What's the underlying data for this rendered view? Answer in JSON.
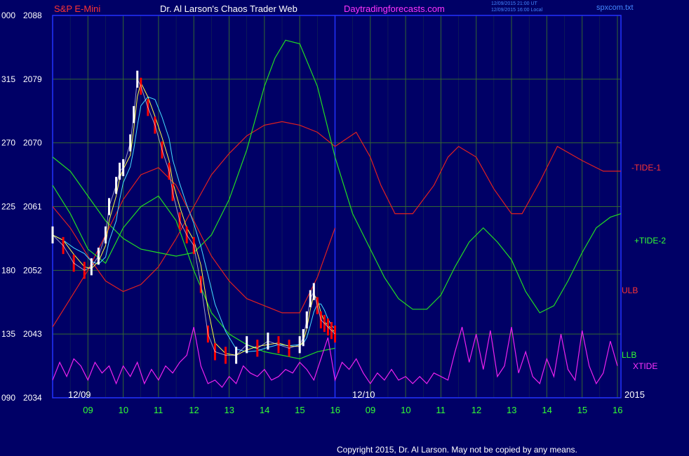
{
  "header": {
    "instrument": "S&P E-Mini",
    "title": "Dr. Al Larson's Chaos Trader Web",
    "site": "Daytradingforecasts.com",
    "timestamp_line1": "12/09/2015 21:00 UT",
    "timestamp_line2": "12/09/2015 16:00 Local",
    "file": "spxcom.txt"
  },
  "footer": {
    "copyright": "Copyright 2015, Dr. Al Larson. May not be copied by any means.",
    "year": "2015"
  },
  "colors": {
    "background": "#000066",
    "grid": "#336633",
    "frame": "#2233ff",
    "price": "#ffffff",
    "price_down": "#ff0000",
    "tide1": "#e02020",
    "tide2": "#22dd22",
    "xtide": "#ee22ee",
    "ma_yellow": "#ffff44",
    "ma_cyan": "#44ddff",
    "ulb": "#e02020",
    "llb": "#22dd22",
    "label_red": "#ff3333",
    "label_green": "#33ff33",
    "label_magenta": "#ff33ff",
    "tick_text": "#ffffff"
  },
  "chart_data": {
    "type": "line",
    "title": "Dr. Al Larson's Chaos Trader Web",
    "y_right_ticks": [
      "2088",
      "2079",
      "2070",
      "2061",
      "2052",
      "2043",
      "2034"
    ],
    "y_left_ticks": [
      "000",
      "315",
      "270",
      "225",
      "180",
      "135",
      "090"
    ],
    "ylim": [
      2034,
      2088
    ],
    "x_ticks": [
      "09",
      "10",
      "11",
      "12",
      "13",
      "14",
      "15",
      "16",
      "09",
      "10",
      "11",
      "12",
      "13",
      "14",
      "15",
      "16"
    ],
    "date_labels": [
      "12/09",
      "12/10"
    ],
    "now_marker": "16 (12/09 close)",
    "series": [
      {
        "name": "S&P E-Mini",
        "kind": "price",
        "x": [
          8.0,
          8.3,
          8.6,
          8.9,
          9.1,
          9.3,
          9.5,
          9.6,
          9.8,
          9.9,
          10.0,
          10.2,
          10.3,
          10.4,
          10.5,
          10.7,
          10.9,
          11.1,
          11.3,
          11.4,
          11.6,
          11.8,
          12.0,
          12.2,
          12.4,
          12.6,
          12.9,
          13.2,
          13.5,
          13.8,
          14.1,
          14.4,
          14.7,
          15.0,
          15.1,
          15.2,
          15.3,
          15.4,
          15.5,
          15.6,
          15.7,
          15.8,
          15.9,
          16.0
        ],
        "y": [
          2057.0,
          2055.5,
          2053.0,
          2052.0,
          2052.5,
          2054.0,
          2057.0,
          2061.0,
          2064.0,
          2066.0,
          2066.5,
          2070.0,
          2074.0,
          2079.0,
          2078.0,
          2075.0,
          2072.5,
          2069.0,
          2066.0,
          2063.0,
          2059.0,
          2057.0,
          2055.5,
          2050.0,
          2043.0,
          2040.5,
          2040.0,
          2040.0,
          2041.5,
          2041.0,
          2042.0,
          2041.5,
          2041.0,
          2041.5,
          2042.5,
          2045.0,
          2048.0,
          2049.0,
          2047.0,
          2045.0,
          2044.5,
          2044.0,
          2043.5,
          2043.0
        ]
      },
      {
        "name": "-TIDE-1",
        "kind": "tide",
        "x": [
          8.0,
          8.5,
          9.0,
          9.5,
          10.0,
          10.5,
          11.0,
          11.5,
          12.0,
          12.5,
          13.0,
          13.5,
          14.0,
          14.5,
          15.0,
          15.5,
          16.0,
          16.6,
          17.0,
          17.3,
          17.7,
          18.2,
          18.8,
          19.2,
          19.5,
          20.0,
          20.5,
          21.0,
          21.3,
          21.8,
          22.3,
          23.0,
          23.6,
          24.1
        ],
        "y": [
          2061.0,
          2058.0,
          2054.0,
          2050.5,
          2049.0,
          2050.0,
          2052.5,
          2056.5,
          2061.0,
          2065.5,
          2068.5,
          2071.0,
          2072.5,
          2073.0,
          2072.5,
          2071.5,
          2069.5,
          2071.5,
          2068.0,
          2064.0,
          2060.0,
          2060.0,
          2064.0,
          2068.0,
          2069.5,
          2068.0,
          2063.5,
          2060.0,
          2060.0,
          2064.5,
          2069.5,
          2067.5,
          2066.0,
          2066.0
        ]
      },
      {
        "name": "+TIDE-2",
        "kind": "tide",
        "x": [
          8.0,
          8.5,
          9.0,
          9.5,
          10.0,
          10.5,
          11.0,
          11.5,
          12.0,
          12.5,
          13.0,
          13.5,
          14.0,
          14.3,
          14.6,
          15.0,
          15.5,
          16.0,
          16.5,
          17.0,
          17.4,
          17.8,
          18.2,
          18.6,
          19.0,
          19.4,
          19.8,
          20.2,
          20.6,
          21.0,
          21.4,
          21.8,
          22.2,
          22.6,
          23.0,
          23.4,
          23.8,
          24.1
        ],
        "y": [
          2068.0,
          2066.0,
          2062.5,
          2059.0,
          2056.5,
          2055.0,
          2054.5,
          2054.0,
          2054.5,
          2057.0,
          2062.0,
          2069.0,
          2078.0,
          2082.0,
          2084.5,
          2084.0,
          2078.0,
          2068.0,
          2060.0,
          2055.0,
          2051.0,
          2048.0,
          2046.5,
          2046.5,
          2048.5,
          2052.5,
          2056.0,
          2058.0,
          2056.0,
          2053.5,
          2049.0,
          2046.0,
          2047.0,
          2050.5,
          2054.5,
          2058.0,
          2059.5,
          2060.0
        ]
      },
      {
        "name": "ULB",
        "kind": "band",
        "x": [
          8.0,
          8.5,
          9.0,
          9.5,
          10.0,
          10.5,
          11.0,
          11.5,
          12.0,
          12.5,
          13.0,
          13.5,
          14.0,
          14.5,
          15.0,
          15.5,
          16.0
        ],
        "y": [
          2044.0,
          2048.0,
          2052.0,
          2057.0,
          2062.0,
          2065.5,
          2066.5,
          2064.0,
          2059.0,
          2054.0,
          2050.5,
          2048.0,
          2047.0,
          2046.0,
          2046.0,
          2051.0,
          2058.0
        ]
      },
      {
        "name": "LLB",
        "kind": "band",
        "x": [
          8.0,
          8.5,
          9.0,
          9.5,
          10.0,
          10.5,
          11.0,
          11.5,
          12.0,
          12.5,
          13.0,
          13.5,
          14.0,
          14.5,
          15.0,
          15.5,
          16.0
        ],
        "y": [
          2064.0,
          2060.0,
          2055.0,
          2053.0,
          2058.0,
          2061.0,
          2062.5,
          2059.0,
          2052.0,
          2046.0,
          2043.0,
          2041.5,
          2040.5,
          2040.0,
          2039.5,
          2040.5,
          2041.0
        ]
      },
      {
        "name": "XTIDE",
        "kind": "tide",
        "x": [
          8.0,
          8.2,
          8.4,
          8.6,
          8.8,
          9.0,
          9.2,
          9.4,
          9.6,
          9.8,
          10.0,
          10.2,
          10.4,
          10.6,
          10.8,
          11.0,
          11.2,
          11.4,
          11.6,
          11.8,
          12.0,
          12.2,
          12.4,
          12.6,
          12.8,
          13.0,
          13.2,
          13.4,
          13.6,
          13.8,
          14.0,
          14.2,
          14.4,
          14.6,
          14.8,
          15.0,
          15.2,
          15.4,
          15.6,
          15.8,
          16.0,
          16.2,
          16.4,
          16.6,
          16.8,
          17.0,
          17.2,
          17.4,
          17.6,
          17.8,
          18.0,
          18.2,
          18.4,
          18.6,
          18.8,
          19.0,
          19.2,
          19.4,
          19.6,
          19.8,
          20.0,
          20.2,
          20.4,
          20.6,
          20.8,
          21.0,
          21.2,
          21.4,
          21.6,
          21.8,
          22.0,
          22.2,
          22.4,
          22.6,
          22.8,
          23.0,
          23.2,
          23.4,
          23.6,
          23.8,
          24.0
        ],
        "y": [
          2036.5,
          2039.0,
          2037.0,
          2039.5,
          2038.5,
          2036.5,
          2039.0,
          2037.5,
          2038.5,
          2036.0,
          2038.5,
          2037.0,
          2039.0,
          2036.0,
          2038.0,
          2036.5,
          2038.5,
          2037.5,
          2039.0,
          2040.0,
          2044.0,
          2038.5,
          2036.0,
          2036.5,
          2035.5,
          2037.0,
          2036.0,
          2038.5,
          2037.5,
          2037.0,
          2038.0,
          2036.5,
          2037.0,
          2038.0,
          2037.5,
          2039.0,
          2038.0,
          2036.5,
          2039.5,
          2042.5,
          2036.5,
          2039.0,
          2038.0,
          2039.5,
          2037.5,
          2036.0,
          2037.5,
          2036.5,
          2038.0,
          2036.5,
          2037.0,
          2036.0,
          2037.0,
          2036.0,
          2037.5,
          2037.0,
          2036.5,
          2040.5,
          2044.0,
          2039.0,
          2043.0,
          2038.0,
          2043.5,
          2037.0,
          2038.5,
          2044.0,
          2037.5,
          2040.5,
          2037.0,
          2036.0,
          2039.5,
          2037.0,
          2043.0,
          2038.0,
          2036.5,
          2043.5,
          2038.5,
          2036.0,
          2037.5,
          2042.0,
          2038.5
        ]
      }
    ],
    "right_labels": [
      "-TIDE-1",
      "+TIDE-2",
      "ULB",
      "LLB",
      "XTIDE"
    ],
    "grid": true
  }
}
